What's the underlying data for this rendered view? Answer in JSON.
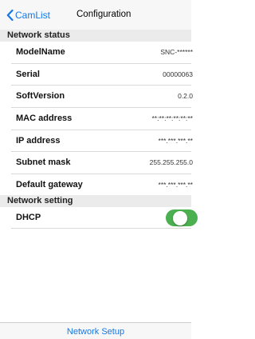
{
  "navbar": {
    "back_label": "CamList",
    "title": "Configuration"
  },
  "network_status": {
    "header": "Network status",
    "rows": [
      {
        "label": "ModelName",
        "value": "SNC-******"
      },
      {
        "label": "Serial",
        "value": "00000063"
      },
      {
        "label": "SoftVersion",
        "value": "0.2.0"
      },
      {
        "label": "MAC address",
        "value": "**:**:**:**:**:**"
      },
      {
        "label": "IP address",
        "value": "***.***.***.**"
      },
      {
        "label": "Subnet mask",
        "value": "255.255.255.0"
      },
      {
        "label": "Default gateway",
        "value": "***.***.***.**"
      }
    ]
  },
  "network_setting": {
    "header": "Network setting",
    "dhcp_label": "DHCP",
    "dhcp_on": true
  },
  "bottom": {
    "button_label": "Network Setup"
  },
  "colors": {
    "accent": "#1478e6",
    "toggle_on": "#4bb04f"
  }
}
